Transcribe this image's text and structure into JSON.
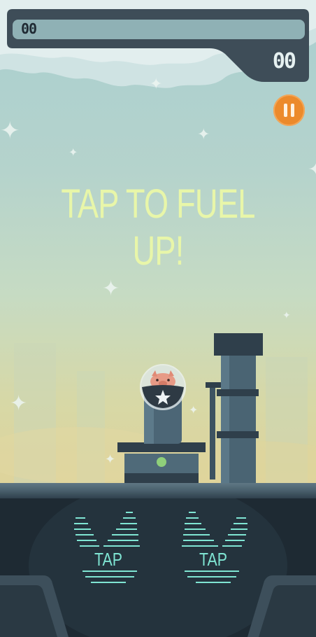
{
  "hud": {
    "left_value": "00",
    "right_value": "00"
  },
  "pause_icon": "pause-icon",
  "prompt": "TAP TO FUEL UP!",
  "controls": {
    "left_tap_label": "TAP",
    "right_tap_label": "TAP"
  },
  "colors": {
    "accent_orange": "#ec8a2b",
    "prompt_yellow": "#e8f6a9",
    "tap_cyan": "#7fe5d3",
    "hud_dark": "#3e4d58"
  }
}
